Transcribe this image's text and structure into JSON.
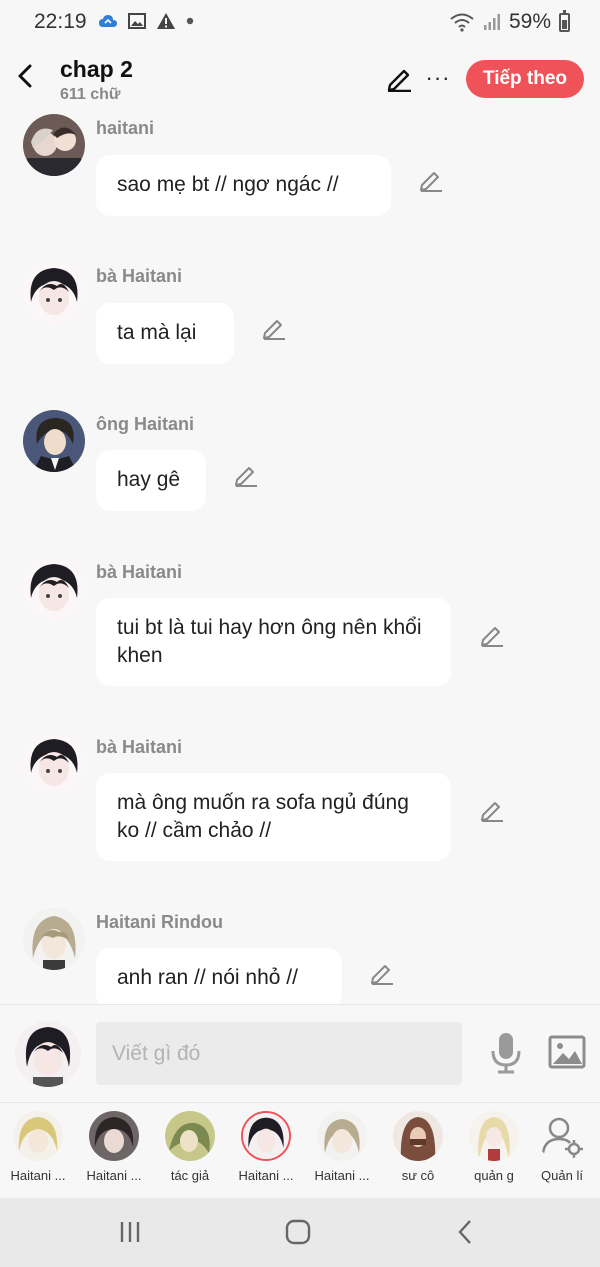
{
  "status_bar": {
    "time": "22:19",
    "battery": "59%",
    "icons_left": [
      "cloud-sync-icon",
      "image-icon",
      "warning-icon",
      "dot-icon"
    ],
    "icons_right": [
      "wifi-icon",
      "signal-icon",
      "battery-icon"
    ]
  },
  "header": {
    "title": "chap 2",
    "subtitle": "611 chữ",
    "next_label": "Tiếp theo",
    "more_label": "···"
  },
  "messages": [
    {
      "sender": "haitani",
      "text": "sao mẹ bt // ngơ ngác //",
      "avatar": "haitani-avatar"
    },
    {
      "sender": "bà Haitani",
      "text": "ta mà lại",
      "avatar": "ba-haitani-avatar"
    },
    {
      "sender": "ông Haitani",
      "text": "hay gê",
      "avatar": "ong-haitani-avatar"
    },
    {
      "sender": "bà Haitani",
      "text": "tui bt là tui hay hơn ông nên khổi khen",
      "avatar": "ba-haitani-avatar"
    },
    {
      "sender": "bà Haitani",
      "text": "mà ông muốn ra sofa ngủ đúng ko // cầm chảo //",
      "avatar": "ba-haitani-avatar"
    },
    {
      "sender": "Haitani Rindou",
      "text": "anh ran // nói nhỏ //",
      "avatar": "haitani-rindou-avatar"
    }
  ],
  "input": {
    "placeholder": "Viết gì đó"
  },
  "characters": [
    {
      "name": "Haitani ...",
      "selected": false
    },
    {
      "name": "Haitani ...",
      "selected": false
    },
    {
      "name": "tác giả",
      "selected": false
    },
    {
      "name": "Haitani ...",
      "selected": true
    },
    {
      "name": "Haitani ...",
      "selected": false
    },
    {
      "name": "sư cô",
      "selected": false
    },
    {
      "name": "quản g",
      "selected": false
    },
    {
      "name": "Quản lí",
      "selected": false
    }
  ],
  "colors": {
    "accent": "#f0525a",
    "background": "#f7f7f7",
    "bubble": "#ffffff",
    "sender_text": "#8a8a8a"
  }
}
